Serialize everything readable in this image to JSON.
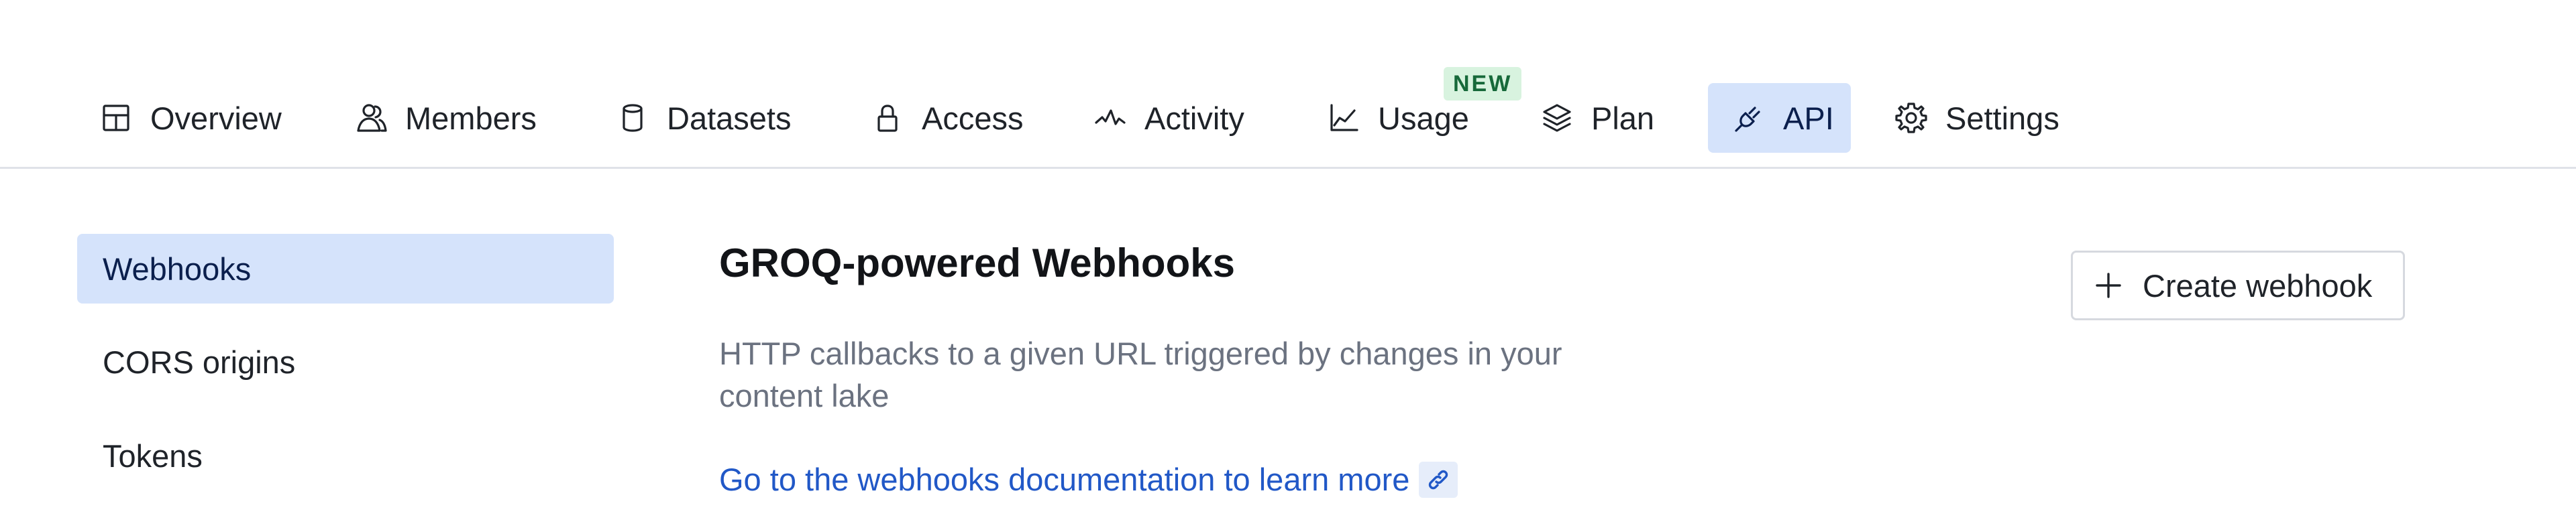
{
  "nav": {
    "tabs": [
      {
        "label": "Overview",
        "icon": "layout-grid-icon"
      },
      {
        "label": "Members",
        "icon": "users-icon"
      },
      {
        "label": "Datasets",
        "icon": "database-icon"
      },
      {
        "label": "Access",
        "icon": "lock-icon"
      },
      {
        "label": "Activity",
        "icon": "activity-icon"
      },
      {
        "label": "Usage",
        "icon": "chart-line-icon",
        "badge": "NEW"
      },
      {
        "label": "Plan",
        "icon": "layers-icon"
      },
      {
        "label": "API",
        "icon": "plug-icon",
        "active": true
      },
      {
        "label": "Settings",
        "icon": "gear-icon"
      }
    ]
  },
  "sidebar": {
    "items": [
      {
        "label": "Webhooks",
        "active": true
      },
      {
        "label": "CORS origins"
      },
      {
        "label": "Tokens"
      }
    ]
  },
  "main": {
    "title": "GROQ-powered Webhooks",
    "description": "HTTP callbacks to a given URL triggered by changes in your content lake",
    "doc_link": "Go to the webhooks documentation to learn more",
    "create_button": "Create webhook"
  },
  "colors": {
    "active_bg": "#d5e3fb",
    "link": "#2158c7",
    "badge_bg": "#d8f3df",
    "badge_text": "#17693a",
    "divider": "#dfe2e8"
  }
}
